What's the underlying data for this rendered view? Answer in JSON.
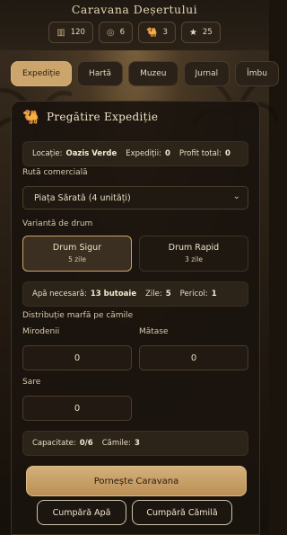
{
  "app": {
    "title": "Caravana Deșertului"
  },
  "stats": [
    {
      "icon": "chest-icon",
      "glyph": "▥",
      "value": "120"
    },
    {
      "icon": "coins-icon",
      "glyph": "◎",
      "value": "6"
    },
    {
      "icon": "camel-icon",
      "glyph": "🐫",
      "value": "3"
    },
    {
      "icon": "star-icon",
      "glyph": "★",
      "value": "25"
    }
  ],
  "tabs": [
    "Expediție",
    "Hartă",
    "Muzeu",
    "Jurnal",
    "Îmbu"
  ],
  "panel": {
    "title": "Pregătire Expediție",
    "summary": {
      "location_label": "Locație:",
      "location_value": "Oazis Verde",
      "expeditions_label": "Expediții:",
      "expeditions_value": "0",
      "profit_label": "Profit total:",
      "profit_value": "0"
    },
    "route_label": "Rută comercială",
    "route_selected": "Piața Sărată (4 unități)",
    "variant_label": "Variantă de drum",
    "variants": [
      {
        "name": "Drum Sigur",
        "days": "5 zile",
        "selected": true
      },
      {
        "name": "Drum Rapid",
        "days": "3 zile",
        "selected": false
      }
    ],
    "needs": {
      "water_label": "Apă necesară:",
      "water_value": "13 butoaie",
      "days_label": "Zile:",
      "days_value": "5",
      "danger_label": "Pericol:",
      "danger_value": "1"
    },
    "distribution_label": "Distribuție marfă pe cămile",
    "goods": [
      {
        "label": "Mirodenii",
        "value": "0"
      },
      {
        "label": "Mătase",
        "value": "0"
      },
      {
        "label": "Sare",
        "value": "0"
      }
    ],
    "capacity": {
      "cap_label": "Capacitate:",
      "cap_value": "0/6",
      "camels_label": "Cămile:",
      "camels_value": "3"
    },
    "start_button": "Pornește Caravana",
    "buy_water_button": "Cumpără Apă",
    "buy_camel_button": "Cumpără Cămilă"
  }
}
